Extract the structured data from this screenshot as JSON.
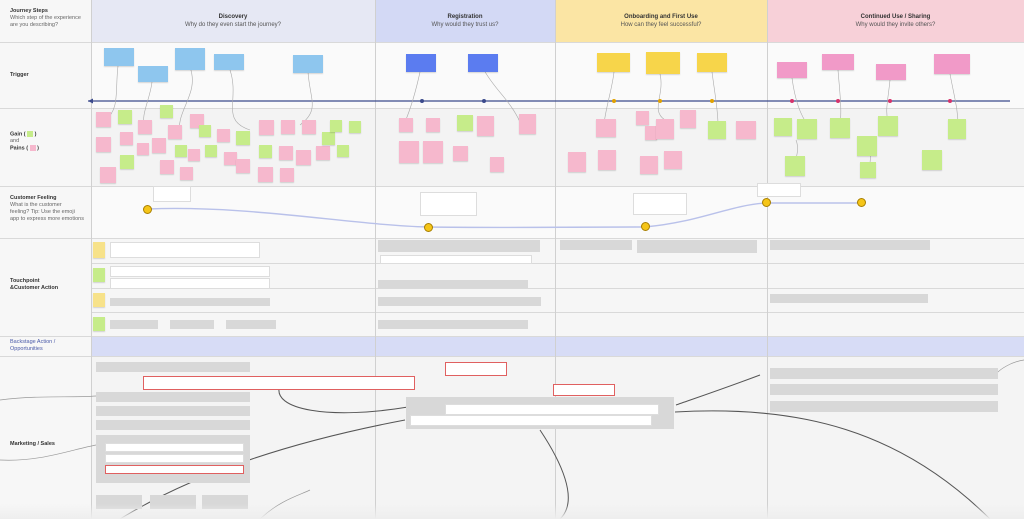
{
  "rows": {
    "journey_steps": {
      "title": "Journey Steps",
      "sub": "Which step of the experience are you describing?"
    },
    "trigger": {
      "title": "Trigger"
    },
    "gain_pains": {
      "title": "Gain (",
      "and": "and",
      "pains": "Pains ("
    },
    "customer_feeling": {
      "title": "Customer Feeling",
      "sub1": "What is the customer",
      "sub2": "feeling? Tip: Use the emoji",
      "sub3": "app to express more emotions"
    },
    "touchpoint": {
      "title": "Touchpoint",
      "title2": "&Customer Action"
    },
    "backstage": {
      "title": "Backstage Action /",
      "title2": "Opportunities"
    },
    "marketing": {
      "title": "Marketing / Sales"
    }
  },
  "stages": [
    {
      "title": "Discovery",
      "subtitle": "Why do they even start the journey?",
      "bg": "#dfe3f6"
    },
    {
      "title": "Registration",
      "subtitle": "Why would they trust us?",
      "bg": "#cfd6f5"
    },
    {
      "title": "Onboarding and   First Use",
      "subtitle": "How can they feel successful?",
      "bg": "#fbe7a8"
    },
    {
      "title": "Continued Use / Sharing",
      "subtitle": "Why would they invite others?",
      "bg": "#f6d3da"
    }
  ],
  "colors": {
    "blue_sticky": "#8ec6ee",
    "dark_blue_sticky": "#5b7cf0",
    "yellow_sticky": "#f7d54a",
    "pink_sticky": "#f19ac8",
    "light_pink": "#f6b8cd",
    "green_sticky": "#c6ec8a",
    "timeline": "#3b4a8c",
    "backstage_band": "#d7dcf6"
  }
}
